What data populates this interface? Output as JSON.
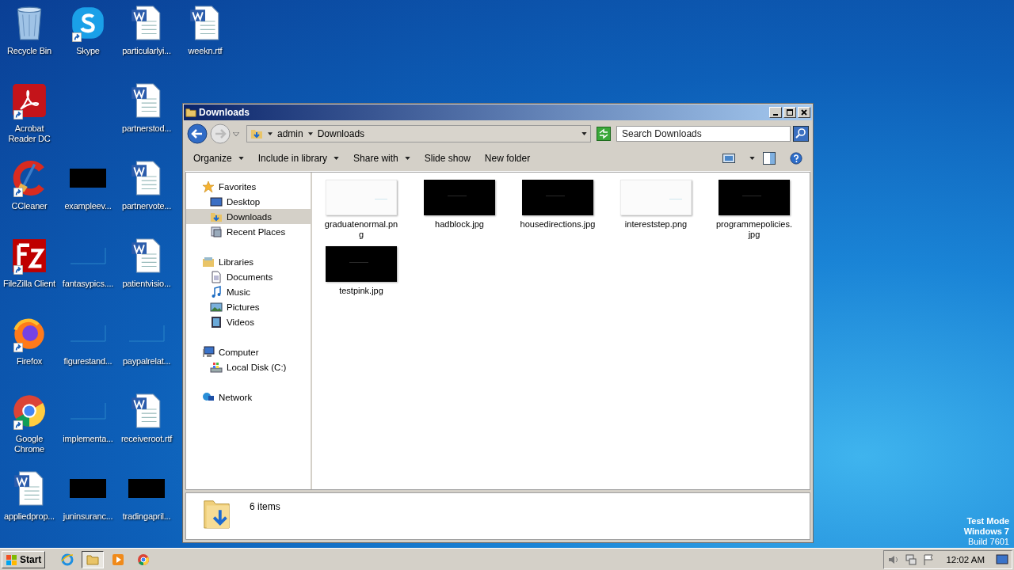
{
  "desktop": {
    "columns": [
      [
        {
          "label": "Recycle Bin",
          "kind": "recycle",
          "shortcut": false
        },
        {
          "label": "Acrobat Reader DC",
          "kind": "acrobat",
          "shortcut": true
        },
        {
          "label": "CCleaner",
          "kind": "ccleaner",
          "shortcut": true
        },
        {
          "label": "FileZilla Client",
          "kind": "filezilla",
          "shortcut": true
        },
        {
          "label": "Firefox",
          "kind": "firefox",
          "shortcut": true
        },
        {
          "label": "Google Chrome",
          "kind": "chrome",
          "shortcut": true
        },
        {
          "label": "appliedprop...",
          "kind": "word",
          "shortcut": false
        }
      ],
      [
        {
          "label": "Skype",
          "kind": "skype",
          "shortcut": true
        },
        {
          "kind": "blank"
        },
        {
          "label": "exampleev...",
          "kind": "black",
          "shortcut": false
        },
        {
          "label": "fantasypics....",
          "kind": "faint",
          "shortcut": false
        },
        {
          "label": "figurestand...",
          "kind": "faint",
          "shortcut": false
        },
        {
          "label": "implementa...",
          "kind": "faint",
          "shortcut": false
        },
        {
          "label": "juninsuranc...",
          "kind": "black",
          "shortcut": false
        }
      ],
      [
        {
          "label": "particularlyi...",
          "kind": "word",
          "shortcut": false
        },
        {
          "label": "partnerstod...",
          "kind": "word",
          "shortcut": false
        },
        {
          "label": "partnervote...",
          "kind": "word",
          "shortcut": false
        },
        {
          "label": "patientvisio...",
          "kind": "word",
          "shortcut": false
        },
        {
          "label": "paypalrelat...",
          "kind": "faint",
          "shortcut": false
        },
        {
          "label": "receiveroot.rtf",
          "kind": "word",
          "shortcut": false
        },
        {
          "label": "tradingapril...",
          "kind": "black",
          "shortcut": false
        }
      ],
      [
        {
          "label": "weekn.rtf",
          "kind": "word",
          "shortcut": false
        }
      ]
    ]
  },
  "window": {
    "title": "Downloads",
    "address": {
      "crumbs": [
        "admin",
        "Downloads"
      ]
    },
    "search": {
      "placeholder": "Search Downloads"
    },
    "commands": [
      {
        "label": "Organize",
        "menu": true
      },
      {
        "label": "Include in library",
        "menu": true
      },
      {
        "label": "Share with",
        "menu": true
      },
      {
        "label": "Slide show",
        "menu": false
      },
      {
        "label": "New folder",
        "menu": false
      }
    ],
    "nav": [
      {
        "label": "Favorites",
        "kind": "favorites",
        "selected": false,
        "children": [
          {
            "label": "Desktop",
            "kind": "desktop",
            "selected": false
          },
          {
            "label": "Downloads",
            "kind": "downloads",
            "selected": true
          },
          {
            "label": "Recent Places",
            "kind": "recent",
            "selected": false
          }
        ]
      },
      {
        "label": "Libraries",
        "kind": "libraries",
        "selected": false,
        "children": [
          {
            "label": "Documents",
            "kind": "documents",
            "selected": false
          },
          {
            "label": "Music",
            "kind": "music",
            "selected": false
          },
          {
            "label": "Pictures",
            "kind": "pictures",
            "selected": false
          },
          {
            "label": "Videos",
            "kind": "videos",
            "selected": false
          }
        ]
      },
      {
        "label": "Computer",
        "kind": "computer",
        "selected": false,
        "children": [
          {
            "label": "Local Disk (C:)",
            "kind": "disk",
            "selected": false
          }
        ]
      },
      {
        "label": "Network",
        "kind": "network",
        "selected": false
      }
    ],
    "files": [
      {
        "name": "graduatenormal.png",
        "kind": "light"
      },
      {
        "name": "hadblock.jpg",
        "kind": "dark"
      },
      {
        "name": "housedirections.jpg",
        "kind": "dark"
      },
      {
        "name": "intereststep.png",
        "kind": "light"
      },
      {
        "name": "programmepolicies.jpg",
        "kind": "dark"
      },
      {
        "name": "testpink.jpg",
        "kind": "dark"
      }
    ],
    "details": {
      "count": "6 items"
    }
  },
  "os_notice": [
    "Test Mode",
    "Windows 7",
    "Build 7601"
  ],
  "taskbar": {
    "start": "Start",
    "apps": [
      {
        "kind": "ie",
        "selected": false
      },
      {
        "kind": "explorer",
        "selected": true
      },
      {
        "kind": "media",
        "selected": false
      },
      {
        "kind": "chrome",
        "selected": false
      }
    ],
    "clock": "12:02 AM"
  }
}
